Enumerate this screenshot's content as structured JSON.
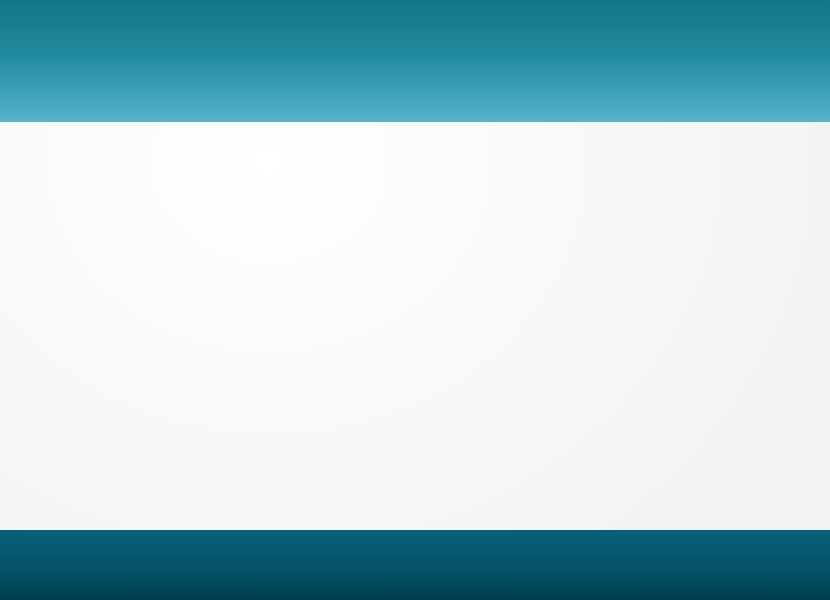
{
  "colors": {
    "header_top": "#137589",
    "header_bottom": "#54b4cb",
    "content_light": "#ffffff",
    "content_edge": "#f3f3f3",
    "footer_top": "#08627b",
    "footer_bottom": "#003f4f"
  }
}
